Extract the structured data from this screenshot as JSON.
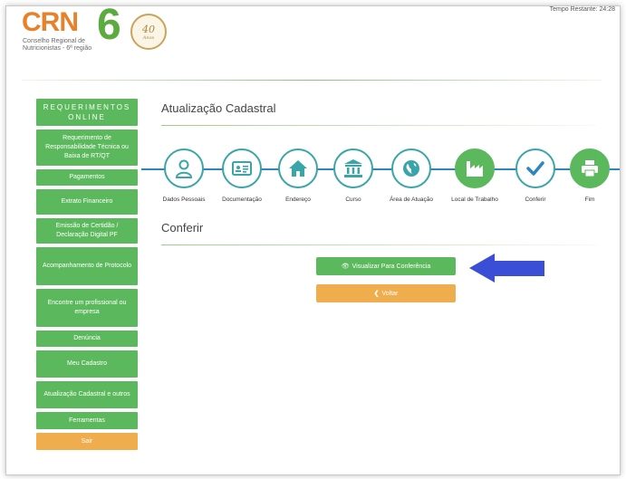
{
  "header": {
    "timer": "Tempo Restante: 24:28",
    "logo_text": "CRN",
    "logo_number": "6",
    "logo_sub": "Conselho Regional de Nutricionistas - 6ª região",
    "seal_number": "40",
    "seal_sub": "Anos"
  },
  "sidebar": {
    "title": "REQUERIMENTOS ONLINE",
    "items": [
      "Requerimento de Responsabilidade Técnica ou Baixa de RT/QT",
      "Pagamentos",
      "Extrato Financeiro",
      "Emissão de Certidão / Declaração Digital PF",
      "Acompanhamento de Protocolo",
      "Encontre um profissional ou empresa",
      "Denúncia",
      "Meu Cadastro",
      "Atualização Cadastral e outros",
      "Ferramentas"
    ],
    "logout": "Sair"
  },
  "main": {
    "title": "Atualização Cadastral",
    "section_title": "Conferir",
    "steps": [
      {
        "label": "Dados Pessoais",
        "icon": "person-icon"
      },
      {
        "label": "Documentação",
        "icon": "id-card-icon"
      },
      {
        "label": "Endereço",
        "icon": "home-icon"
      },
      {
        "label": "Curso",
        "icon": "institution-icon"
      },
      {
        "label": "Área de Atuação",
        "icon": "globe-icon"
      },
      {
        "label": "Local de Trabalho",
        "icon": "industry-icon"
      },
      {
        "label": "Conferir",
        "icon": "check-icon"
      },
      {
        "label": "Fim",
        "icon": "print-icon"
      }
    ],
    "view_button": "Visualizar Para Conferência",
    "back_button": "Voltar"
  },
  "colors": {
    "green": "#5cb85c",
    "orange": "#f0ad4e",
    "teal": "#3aa5a8",
    "blue_line": "#2e86c1",
    "arrow": "#3b4fd6"
  }
}
